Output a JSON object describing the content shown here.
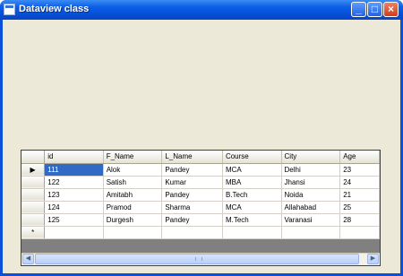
{
  "window": {
    "title": "Dataview class",
    "minimize": "_",
    "maximize": "□",
    "close": "×"
  },
  "grid": {
    "columns": [
      "id",
      "F_Name",
      "L_Name",
      "Course",
      "City",
      "Age"
    ],
    "rows": [
      [
        "111",
        "Alok",
        "Pandey",
        "MCA",
        "Delhi",
        "23"
      ],
      [
        "122",
        "Satish",
        "Kumar",
        "MBA",
        "Jhansi",
        "24"
      ],
      [
        "123",
        "Amitabh",
        "Pandey",
        "B.Tech",
        "Noida",
        "21"
      ],
      [
        "124",
        "Pramod",
        "Sharma",
        "MCA",
        "Allahabad",
        "25"
      ],
      [
        "125",
        "Durgesh",
        "Pandey",
        "M.Tech",
        "Varanasi",
        "28"
      ]
    ],
    "current_row_marker": "▶",
    "new_row_marker": "*",
    "selected_cell": {
      "row": 0,
      "column": "id"
    }
  },
  "scrollbar": {
    "left_arrow": "◀",
    "right_arrow": "▶"
  },
  "colors": {
    "titlebar": "#0550d8",
    "client_bg": "#ece9d8",
    "selection": "#316ac5"
  }
}
